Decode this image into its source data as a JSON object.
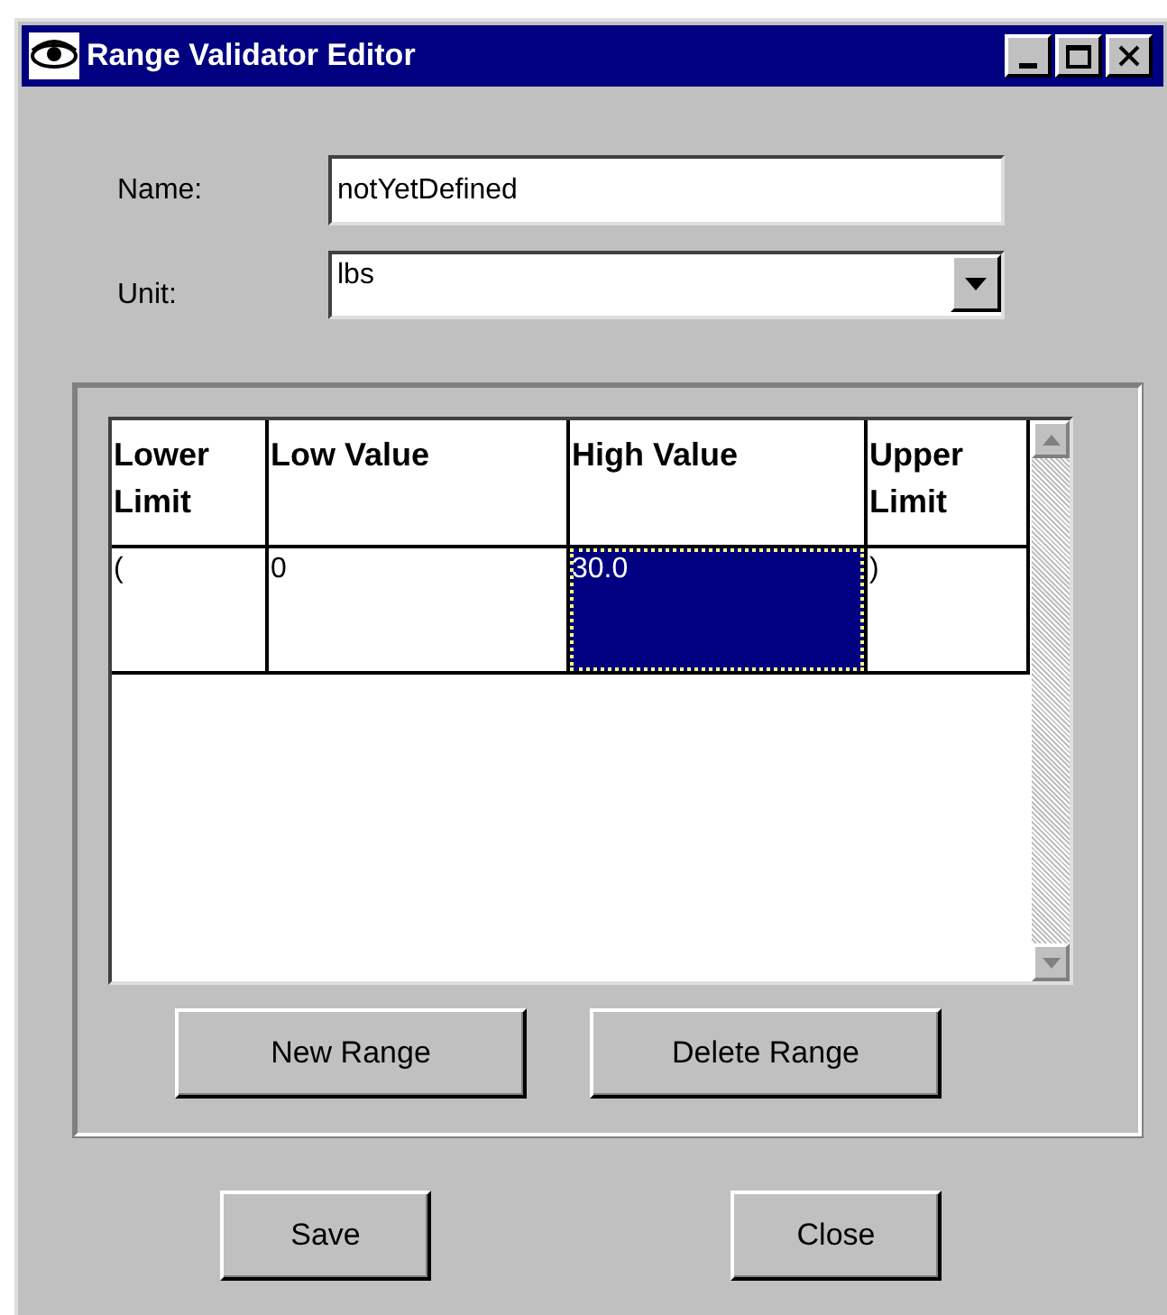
{
  "window": {
    "title": "Range Validator Editor"
  },
  "name_field": {
    "label": "Name:",
    "value": "notYetDefined"
  },
  "unit_field": {
    "label": "Unit:",
    "value": "lbs"
  },
  "table": {
    "columns": [
      "Lower Limit",
      "Low Value",
      "High Value",
      "Upper Limit"
    ],
    "rows": [
      {
        "cells": [
          {
            "text": "(",
            "selected": false
          },
          {
            "text": "0",
            "selected": false
          },
          {
            "text": "30.0",
            "selected": true
          },
          {
            "text": ")",
            "selected": false
          }
        ]
      }
    ]
  },
  "range_buttons": [
    "New Range",
    "Delete Range"
  ],
  "buttons": [
    "Save",
    "Close"
  ]
}
